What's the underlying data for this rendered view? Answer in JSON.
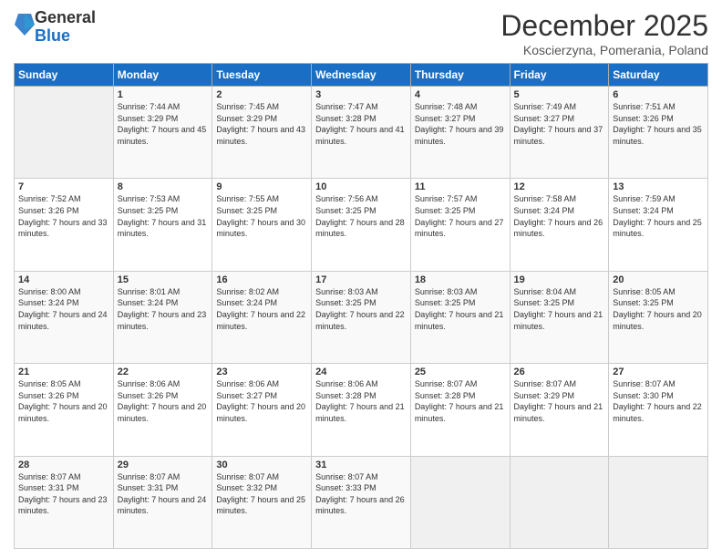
{
  "logo": {
    "general": "General",
    "blue": "Blue"
  },
  "title": "December 2025",
  "location": "Koscierzyna, Pomerania, Poland",
  "days_of_week": [
    "Sunday",
    "Monday",
    "Tuesday",
    "Wednesday",
    "Thursday",
    "Friday",
    "Saturday"
  ],
  "weeks": [
    [
      {
        "day": "",
        "info": ""
      },
      {
        "day": "1",
        "sunrise": "Sunrise: 7:44 AM",
        "sunset": "Sunset: 3:29 PM",
        "daylight": "Daylight: 7 hours and 45 minutes."
      },
      {
        "day": "2",
        "sunrise": "Sunrise: 7:45 AM",
        "sunset": "Sunset: 3:29 PM",
        "daylight": "Daylight: 7 hours and 43 minutes."
      },
      {
        "day": "3",
        "sunrise": "Sunrise: 7:47 AM",
        "sunset": "Sunset: 3:28 PM",
        "daylight": "Daylight: 7 hours and 41 minutes."
      },
      {
        "day": "4",
        "sunrise": "Sunrise: 7:48 AM",
        "sunset": "Sunset: 3:27 PM",
        "daylight": "Daylight: 7 hours and 39 minutes."
      },
      {
        "day": "5",
        "sunrise": "Sunrise: 7:49 AM",
        "sunset": "Sunset: 3:27 PM",
        "daylight": "Daylight: 7 hours and 37 minutes."
      },
      {
        "day": "6",
        "sunrise": "Sunrise: 7:51 AM",
        "sunset": "Sunset: 3:26 PM",
        "daylight": "Daylight: 7 hours and 35 minutes."
      }
    ],
    [
      {
        "day": "7",
        "sunrise": "Sunrise: 7:52 AM",
        "sunset": "Sunset: 3:26 PM",
        "daylight": "Daylight: 7 hours and 33 minutes."
      },
      {
        "day": "8",
        "sunrise": "Sunrise: 7:53 AM",
        "sunset": "Sunset: 3:25 PM",
        "daylight": "Daylight: 7 hours and 31 minutes."
      },
      {
        "day": "9",
        "sunrise": "Sunrise: 7:55 AM",
        "sunset": "Sunset: 3:25 PM",
        "daylight": "Daylight: 7 hours and 30 minutes."
      },
      {
        "day": "10",
        "sunrise": "Sunrise: 7:56 AM",
        "sunset": "Sunset: 3:25 PM",
        "daylight": "Daylight: 7 hours and 28 minutes."
      },
      {
        "day": "11",
        "sunrise": "Sunrise: 7:57 AM",
        "sunset": "Sunset: 3:25 PM",
        "daylight": "Daylight: 7 hours and 27 minutes."
      },
      {
        "day": "12",
        "sunrise": "Sunrise: 7:58 AM",
        "sunset": "Sunset: 3:24 PM",
        "daylight": "Daylight: 7 hours and 26 minutes."
      },
      {
        "day": "13",
        "sunrise": "Sunrise: 7:59 AM",
        "sunset": "Sunset: 3:24 PM",
        "daylight": "Daylight: 7 hours and 25 minutes."
      }
    ],
    [
      {
        "day": "14",
        "sunrise": "Sunrise: 8:00 AM",
        "sunset": "Sunset: 3:24 PM",
        "daylight": "Daylight: 7 hours and 24 minutes."
      },
      {
        "day": "15",
        "sunrise": "Sunrise: 8:01 AM",
        "sunset": "Sunset: 3:24 PM",
        "daylight": "Daylight: 7 hours and 23 minutes."
      },
      {
        "day": "16",
        "sunrise": "Sunrise: 8:02 AM",
        "sunset": "Sunset: 3:24 PM",
        "daylight": "Daylight: 7 hours and 22 minutes."
      },
      {
        "day": "17",
        "sunrise": "Sunrise: 8:03 AM",
        "sunset": "Sunset: 3:25 PM",
        "daylight": "Daylight: 7 hours and 22 minutes."
      },
      {
        "day": "18",
        "sunrise": "Sunrise: 8:03 AM",
        "sunset": "Sunset: 3:25 PM",
        "daylight": "Daylight: 7 hours and 21 minutes."
      },
      {
        "day": "19",
        "sunrise": "Sunrise: 8:04 AM",
        "sunset": "Sunset: 3:25 PM",
        "daylight": "Daylight: 7 hours and 21 minutes."
      },
      {
        "day": "20",
        "sunrise": "Sunrise: 8:05 AM",
        "sunset": "Sunset: 3:25 PM",
        "daylight": "Daylight: 7 hours and 20 minutes."
      }
    ],
    [
      {
        "day": "21",
        "sunrise": "Sunrise: 8:05 AM",
        "sunset": "Sunset: 3:26 PM",
        "daylight": "Daylight: 7 hours and 20 minutes."
      },
      {
        "day": "22",
        "sunrise": "Sunrise: 8:06 AM",
        "sunset": "Sunset: 3:26 PM",
        "daylight": "Daylight: 7 hours and 20 minutes."
      },
      {
        "day": "23",
        "sunrise": "Sunrise: 8:06 AM",
        "sunset": "Sunset: 3:27 PM",
        "daylight": "Daylight: 7 hours and 20 minutes."
      },
      {
        "day": "24",
        "sunrise": "Sunrise: 8:06 AM",
        "sunset": "Sunset: 3:28 PM",
        "daylight": "Daylight: 7 hours and 21 minutes."
      },
      {
        "day": "25",
        "sunrise": "Sunrise: 8:07 AM",
        "sunset": "Sunset: 3:28 PM",
        "daylight": "Daylight: 7 hours and 21 minutes."
      },
      {
        "day": "26",
        "sunrise": "Sunrise: 8:07 AM",
        "sunset": "Sunset: 3:29 PM",
        "daylight": "Daylight: 7 hours and 21 minutes."
      },
      {
        "day": "27",
        "sunrise": "Sunrise: 8:07 AM",
        "sunset": "Sunset: 3:30 PM",
        "daylight": "Daylight: 7 hours and 22 minutes."
      }
    ],
    [
      {
        "day": "28",
        "sunrise": "Sunrise: 8:07 AM",
        "sunset": "Sunset: 3:31 PM",
        "daylight": "Daylight: 7 hours and 23 minutes."
      },
      {
        "day": "29",
        "sunrise": "Sunrise: 8:07 AM",
        "sunset": "Sunset: 3:31 PM",
        "daylight": "Daylight: 7 hours and 24 minutes."
      },
      {
        "day": "30",
        "sunrise": "Sunrise: 8:07 AM",
        "sunset": "Sunset: 3:32 PM",
        "daylight": "Daylight: 7 hours and 25 minutes."
      },
      {
        "day": "31",
        "sunrise": "Sunrise: 8:07 AM",
        "sunset": "Sunset: 3:33 PM",
        "daylight": "Daylight: 7 hours and 26 minutes."
      },
      {
        "day": "",
        "info": ""
      },
      {
        "day": "",
        "info": ""
      },
      {
        "day": "",
        "info": ""
      }
    ]
  ]
}
